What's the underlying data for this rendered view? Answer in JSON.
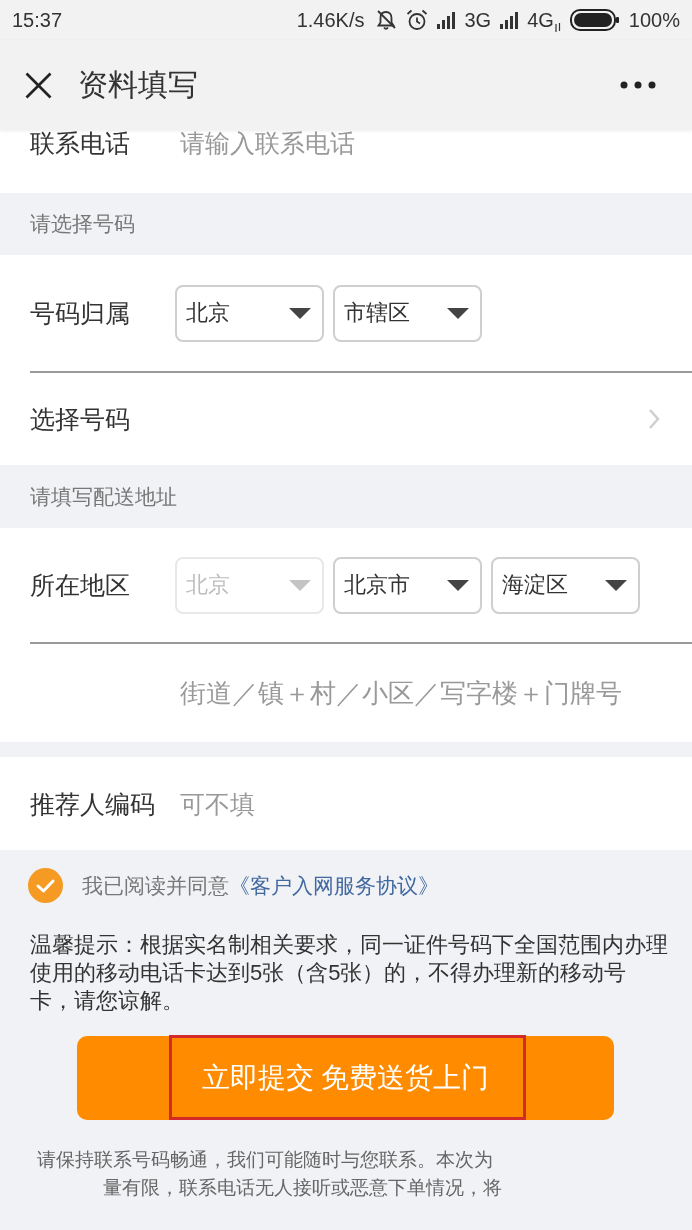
{
  "status_bar": {
    "time": "15:37",
    "network_speed": "1.46K/s",
    "network_1": "3G",
    "network_2": "4G",
    "battery": "100%"
  },
  "nav_bar": {
    "title": "资料填写"
  },
  "contact": {
    "label": "联系电话",
    "placeholder": "请输入联系电话"
  },
  "number_section": {
    "header": "请选择号码",
    "location_label": "号码归属",
    "dropdowns": [
      {
        "value": "北京",
        "disabled": false
      },
      {
        "value": "市辖区",
        "disabled": false
      }
    ],
    "choose_label": "选择号码"
  },
  "address_section": {
    "header": "请填写配送地址",
    "region_label": "所在地区",
    "dropdowns": [
      {
        "value": "北京",
        "disabled": true
      },
      {
        "value": "北京市",
        "disabled": false
      },
      {
        "value": "海淀区",
        "disabled": false
      }
    ],
    "address_placeholder": "街道／镇＋村／小区／写字楼＋门牌号"
  },
  "referrer": {
    "label": "推荐人编码",
    "placeholder": "可不填"
  },
  "agreement": {
    "checked": true,
    "text": "我已阅读并同意",
    "link": "《客户入网服务协议》"
  },
  "notice": "温馨提示：根据实名制相关要求，同一证件号码下全国范围内办理使用的移动电话卡达到5张（含5张）的，不得办理新的移动号卡，请您谅解。",
  "submit_button": "立即提交 免费送货上门",
  "footer_note": [
    "请保持联系号码畅通，我们可能随时与您联系。本次为",
    "量有限，联系电话无人接听或恶意下单情况，将"
  ]
}
